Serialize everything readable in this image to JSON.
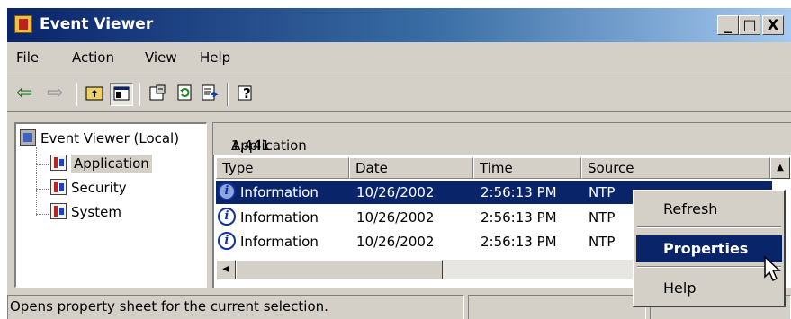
{
  "window": {
    "title": "Event Viewer"
  },
  "title_buttons": {
    "minimize": "_",
    "maximize": "□",
    "close": "X"
  },
  "menubar": [
    "File",
    "Action",
    "View",
    "Help"
  ],
  "toolbar": {
    "icons": [
      "back-icon",
      "forward-icon",
      "up-folder-icon",
      "show-hide-tree-icon",
      "properties-icon",
      "refresh-icon",
      "export-list-icon",
      "help-icon"
    ]
  },
  "tree": {
    "root": "Event Viewer (Local)",
    "items": [
      "Application",
      "Security",
      "System"
    ]
  },
  "list": {
    "header_name": "Application",
    "header_count": "1,441 event(s)",
    "columns": [
      "Type",
      "Date",
      "Time",
      "Source"
    ],
    "rows": [
      {
        "type": "Information",
        "date": "10/26/2002",
        "time": "2:56:13 PM",
        "source": "NTP"
      },
      {
        "type": "Information",
        "date": "10/26/2002",
        "time": "2:56:13 PM",
        "source": "NTP"
      },
      {
        "type": "Information",
        "date": "10/26/2002",
        "time": "2:56:13 PM",
        "source": "NTP"
      }
    ]
  },
  "context_menu": [
    "Refresh",
    "Properties",
    "Help"
  ],
  "statusbar": {
    "text": "Opens property sheet for the current selection."
  },
  "colors": {
    "title_start": "#0a246a",
    "title_end": "#a6caf0",
    "selection": "#0a246a",
    "face": "#d4d0c8"
  }
}
